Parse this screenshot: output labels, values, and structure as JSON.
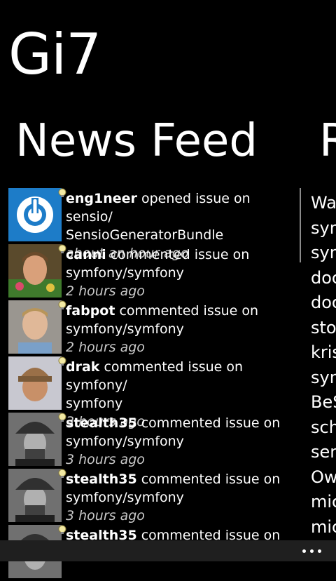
{
  "app": {
    "title": "Gi7"
  },
  "pivot": {
    "current": "News Feed",
    "next": "R"
  },
  "feed": [
    {
      "user": "eng1neer",
      "action": " opened issue on sensio/",
      "repo": "SensioGeneratorBundle",
      "time": "about an hour ago",
      "avatar": "power-avatar"
    },
    {
      "user": "canni",
      "action": " commented issue on",
      "repo": "symfony/symfony",
      "time": "2 hours ago",
      "avatar": "photo-avatar"
    },
    {
      "user": "fabpot",
      "action": " commented issue on",
      "repo": "symfony/symfony",
      "time": "2 hours ago",
      "avatar": "photo-avatar"
    },
    {
      "user": "drak",
      "action": " commented issue on symfony/",
      "repo": "symfony",
      "time": "3 hours ago",
      "avatar": "photo-avatar"
    },
    {
      "user": "stealth35",
      "action": " commented issue on",
      "repo": "symfony/symfony",
      "time": "3 hours ago",
      "avatar": "photo-avatar"
    },
    {
      "user": "stealth35",
      "action": " commented issue on",
      "repo": "symfony/symfony",
      "time": "3 hours ago",
      "avatar": "photo-avatar"
    },
    {
      "user": "stealth35",
      "action": " commented issue on",
      "repo": "",
      "time": "",
      "avatar": "photo-avatar"
    }
  ],
  "next_pane_items": [
    "Wa",
    "sym",
    "sym",
    "doc",
    "doc",
    "stot",
    "kris",
    "sym",
    "BeS",
    "sch",
    "sen",
    "Ow",
    "mic",
    "mic"
  ],
  "appbar": {
    "more_icon": "ellipsis-icon"
  }
}
